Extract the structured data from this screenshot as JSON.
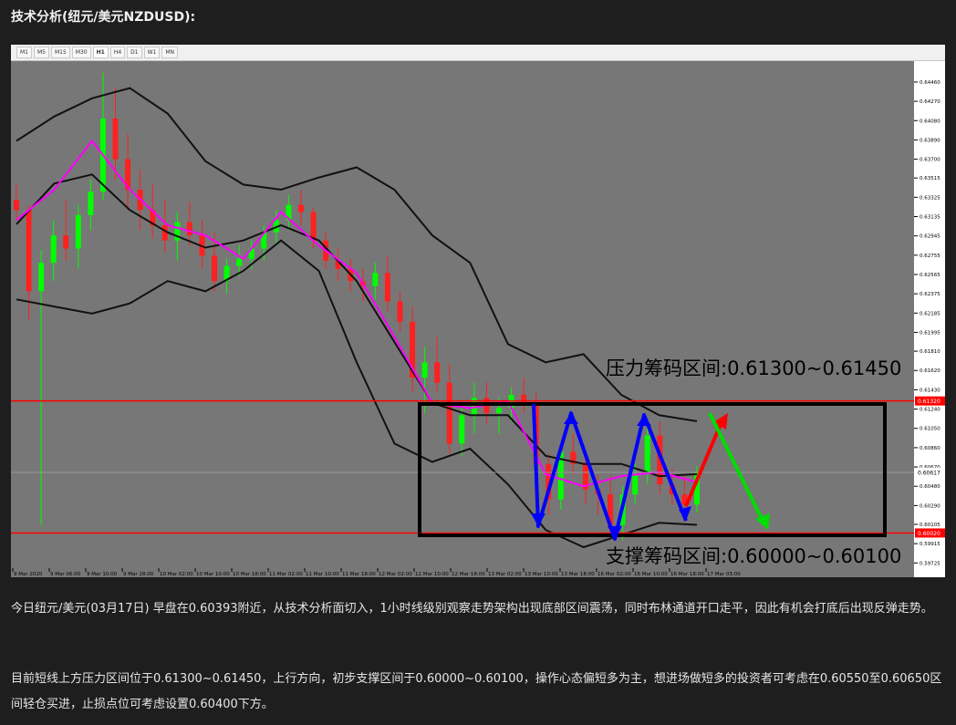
{
  "heading": "技术分析(纽元/美元NZDUSD):",
  "timeframes": [
    "M1",
    "M5",
    "M15",
    "M30",
    "H1",
    "H4",
    "D1",
    "W1",
    "MN"
  ],
  "active_timeframe": "H1",
  "chart_data": {
    "type": "candlestick",
    "symbol": "NZDUSD",
    "timeframe": "H1",
    "ylim": [
      0.5962,
      0.6463
    ],
    "y_ticks": [
      "0.64460",
      "0.64270",
      "0.64080",
      "0.63890",
      "0.63700",
      "0.63515",
      "0.63325",
      "0.63135",
      "0.62945",
      "0.62755",
      "0.62565",
      "0.62375",
      "0.62185",
      "0.61995",
      "0.61810",
      "0.61620",
      "0.61430",
      "0.61240",
      "0.61050",
      "0.60860",
      "0.60670",
      "0.60480",
      "0.60290",
      "0.60105",
      "0.59915",
      "0.59725"
    ],
    "x_ticks": [
      "9 Mar 2020",
      "9 Mar 06:00",
      "9 Mar 10:00",
      "9 Mar 18:00",
      "10 Mar 02:00",
      "10 Mar 10:00",
      "10 Mar 18:00",
      "11 Mar 02:00",
      "11 Mar 10:00",
      "11 Mar 18:00",
      "12 Mar 02:00",
      "12 Mar 10:00",
      "12 Mar 18:00",
      "13 Mar 02:00",
      "13 Mar 10:00",
      "13 Mar 18:00",
      "16 Mar 02:00",
      "16 Mar 10:00",
      "16 Mar 18:00",
      "17 Mar 03:00"
    ],
    "current_price_label": "0.60617",
    "resistance_line_label": "0.61320",
    "support_line_label": "0.60020",
    "bollinger": {
      "upper": [
        0.6388,
        0.6412,
        0.643,
        0.644,
        0.6415,
        0.6368,
        0.6345,
        0.634,
        0.6352,
        0.6362,
        0.634,
        0.6295,
        0.6268,
        0.6188,
        0.617,
        0.6178,
        0.6138,
        0.6118,
        0.6112
      ],
      "middle": [
        0.6306,
        0.6346,
        0.6355,
        0.632,
        0.6298,
        0.6283,
        0.629,
        0.6305,
        0.629,
        0.625,
        0.619,
        0.613,
        0.6118,
        0.6118,
        0.6078,
        0.607,
        0.607,
        0.6058,
        0.606
      ],
      "lower": [
        0.6232,
        0.6225,
        0.6218,
        0.6228,
        0.625,
        0.624,
        0.626,
        0.629,
        0.626,
        0.617,
        0.609,
        0.6072,
        0.6085,
        0.605,
        0.6005,
        0.5988,
        0.6,
        0.6012,
        0.601
      ]
    },
    "moving_average": [
      0.631,
      0.634,
      0.6388,
      0.634,
      0.6305,
      0.6295,
      0.6272,
      0.6318,
      0.6285,
      0.6258,
      0.6195,
      0.613,
      0.6125,
      0.6132,
      0.606,
      0.6048,
      0.6058,
      0.6062,
      0.6052
    ],
    "candles": [
      {
        "o": 0.633,
        "h": 0.6345,
        "l": 0.631,
        "c": 0.632
      },
      {
        "o": 0.632,
        "h": 0.6325,
        "l": 0.6212,
        "c": 0.624
      },
      {
        "o": 0.624,
        "h": 0.628,
        "l": 0.601,
        "c": 0.6268
      },
      {
        "o": 0.6268,
        "h": 0.631,
        "l": 0.625,
        "c": 0.6295
      },
      {
        "o": 0.6295,
        "h": 0.633,
        "l": 0.627,
        "c": 0.6282
      },
      {
        "o": 0.6282,
        "h": 0.6325,
        "l": 0.6262,
        "c": 0.6315
      },
      {
        "o": 0.6315,
        "h": 0.635,
        "l": 0.63,
        "c": 0.6338
      },
      {
        "o": 0.6338,
        "h": 0.6455,
        "l": 0.633,
        "c": 0.641
      },
      {
        "o": 0.641,
        "h": 0.644,
        "l": 0.635,
        "c": 0.637
      },
      {
        "o": 0.637,
        "h": 0.6395,
        "l": 0.632,
        "c": 0.634
      },
      {
        "o": 0.634,
        "h": 0.636,
        "l": 0.63,
        "c": 0.632
      },
      {
        "o": 0.632,
        "h": 0.6345,
        "l": 0.6292,
        "c": 0.6305
      },
      {
        "o": 0.6305,
        "h": 0.633,
        "l": 0.6278,
        "c": 0.629
      },
      {
        "o": 0.629,
        "h": 0.6318,
        "l": 0.627,
        "c": 0.6308
      },
      {
        "o": 0.6308,
        "h": 0.6328,
        "l": 0.6285,
        "c": 0.6295
      },
      {
        "o": 0.6295,
        "h": 0.631,
        "l": 0.6262,
        "c": 0.6275
      },
      {
        "o": 0.6275,
        "h": 0.6298,
        "l": 0.624,
        "c": 0.625
      },
      {
        "o": 0.625,
        "h": 0.6272,
        "l": 0.6238,
        "c": 0.6265
      },
      {
        "o": 0.6265,
        "h": 0.6285,
        "l": 0.6255,
        "c": 0.6272
      },
      {
        "o": 0.6272,
        "h": 0.629,
        "l": 0.6262,
        "c": 0.6282
      },
      {
        "o": 0.6282,
        "h": 0.6305,
        "l": 0.627,
        "c": 0.6298
      },
      {
        "o": 0.6298,
        "h": 0.632,
        "l": 0.6285,
        "c": 0.631
      },
      {
        "o": 0.631,
        "h": 0.6335,
        "l": 0.63,
        "c": 0.6325
      },
      {
        "o": 0.6325,
        "h": 0.634,
        "l": 0.6305,
        "c": 0.6318
      },
      {
        "o": 0.6318,
        "h": 0.6322,
        "l": 0.6282,
        "c": 0.629
      },
      {
        "o": 0.629,
        "h": 0.6298,
        "l": 0.6262,
        "c": 0.627
      },
      {
        "o": 0.627,
        "h": 0.6282,
        "l": 0.625,
        "c": 0.6262
      },
      {
        "o": 0.6262,
        "h": 0.6272,
        "l": 0.624,
        "c": 0.625
      },
      {
        "o": 0.625,
        "h": 0.6262,
        "l": 0.623,
        "c": 0.6245
      },
      {
        "o": 0.6245,
        "h": 0.6268,
        "l": 0.6232,
        "c": 0.6258
      },
      {
        "o": 0.6258,
        "h": 0.6275,
        "l": 0.622,
        "c": 0.623
      },
      {
        "o": 0.623,
        "h": 0.624,
        "l": 0.62,
        "c": 0.621
      },
      {
        "o": 0.621,
        "h": 0.6225,
        "l": 0.614,
        "c": 0.6155
      },
      {
        "o": 0.6155,
        "h": 0.6185,
        "l": 0.612,
        "c": 0.617
      },
      {
        "o": 0.617,
        "h": 0.6195,
        "l": 0.614,
        "c": 0.615
      },
      {
        "o": 0.615,
        "h": 0.6168,
        "l": 0.608,
        "c": 0.609
      },
      {
        "o": 0.609,
        "h": 0.6128,
        "l": 0.6078,
        "c": 0.6118
      },
      {
        "o": 0.6118,
        "h": 0.615,
        "l": 0.61,
        "c": 0.6135
      },
      {
        "o": 0.6135,
        "h": 0.615,
        "l": 0.611,
        "c": 0.612
      },
      {
        "o": 0.612,
        "h": 0.6135,
        "l": 0.61,
        "c": 0.6125
      },
      {
        "o": 0.6125,
        "h": 0.6145,
        "l": 0.6112,
        "c": 0.6138
      },
      {
        "o": 0.6138,
        "h": 0.6155,
        "l": 0.612,
        "c": 0.613
      },
      {
        "o": 0.613,
        "h": 0.614,
        "l": 0.606,
        "c": 0.607
      },
      {
        "o": 0.607,
        "h": 0.608,
        "l": 0.602,
        "c": 0.6035
      },
      {
        "o": 0.6035,
        "h": 0.609,
        "l": 0.6025,
        "c": 0.6082
      },
      {
        "o": 0.6082,
        "h": 0.61,
        "l": 0.606,
        "c": 0.607
      },
      {
        "o": 0.607,
        "h": 0.608,
        "l": 0.603,
        "c": 0.6045
      },
      {
        "o": 0.6045,
        "h": 0.606,
        "l": 0.602,
        "c": 0.604
      },
      {
        "o": 0.604,
        "h": 0.6058,
        "l": 0.6,
        "c": 0.601
      },
      {
        "o": 0.601,
        "h": 0.6048,
        "l": 0.5995,
        "c": 0.604
      },
      {
        "o": 0.604,
        "h": 0.607,
        "l": 0.603,
        "c": 0.606
      },
      {
        "o": 0.606,
        "h": 0.611,
        "l": 0.605,
        "c": 0.6098
      },
      {
        "o": 0.6098,
        "h": 0.6112,
        "l": 0.604,
        "c": 0.605
      },
      {
        "o": 0.605,
        "h": 0.6065,
        "l": 0.603,
        "c": 0.604
      },
      {
        "o": 0.604,
        "h": 0.606,
        "l": 0.602,
        "c": 0.603
      },
      {
        "o": 0.603,
        "h": 0.6068,
        "l": 0.6022,
        "c": 0.6062
      }
    ],
    "annotations": {
      "resistance_zone": "压力筹码区间:0.61300~0.61450",
      "support_zone": "支撑筹码区间:0.60000~0.60100"
    }
  },
  "colors": {
    "chart_bg": "#777777",
    "bull": "#00ff00",
    "bear": "#ff2020",
    "bands": "#111111",
    "ma": "#ff00ff",
    "level_line": "#ff0000",
    "zone_box": "#000000",
    "blue_arrow": "#0000ff",
    "red_arrow": "#ff0000",
    "green_arrow": "#00dd00"
  },
  "paragraphs": [
    "今日纽元/美元(03月17日) 早盘在0.60393附近，从技术分析面切入，1小时线级别观察走势架构出现底部区间震荡，同时布林通道开口走平，因此有机会打底后出现反弹走势。",
    "目前短线上方压力区间位于0.61300~0.61450，上行方向，初步支撑区间于0.60000~0.60100，操作心态偏短多为主，想进场做短多的投资者可考虑在0.60550至0.60650区间轻仓买进，止损点位可考虑设置0.60400下方。"
  ]
}
